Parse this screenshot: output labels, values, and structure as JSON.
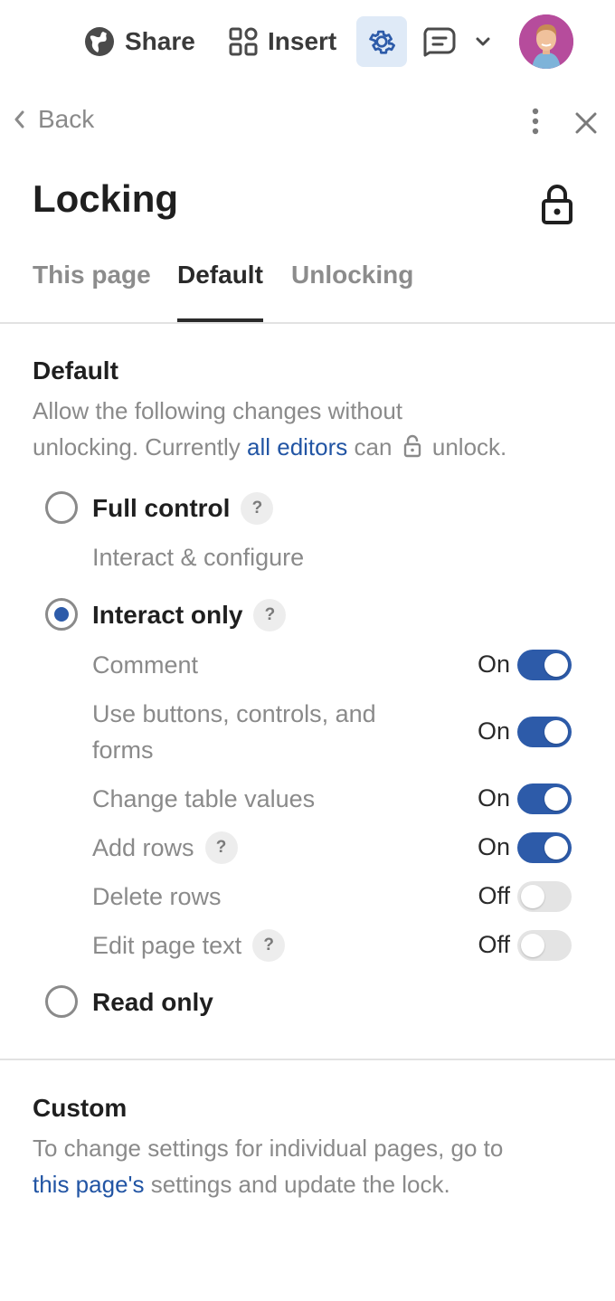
{
  "toolbar": {
    "share_label": "Share",
    "insert_label": "Insert"
  },
  "nav": {
    "back_label": "Back"
  },
  "panel": {
    "title": "Locking",
    "tabs": [
      {
        "label": "This page",
        "active": false
      },
      {
        "label": "Default",
        "active": true
      },
      {
        "label": "Unlocking",
        "active": false
      }
    ]
  },
  "default_section": {
    "title": "Default",
    "desc_line1": "Allow the following changes without",
    "desc_prefix": "unlocking. Currently ",
    "desc_link": "all editors",
    "desc_mid": " can ",
    "desc_suffix": " unlock.",
    "options": [
      {
        "label": "Full control",
        "sub": "Interact & configure",
        "selected": false
      },
      {
        "label": "Interact only",
        "selected": true
      },
      {
        "label": "Read only",
        "selected": false
      }
    ],
    "permissions": [
      {
        "label": "Comment",
        "state": "On"
      },
      {
        "label": "Use buttons, controls, and forms",
        "state": "On"
      },
      {
        "label": "Change table values",
        "state": "On"
      },
      {
        "label": "Add rows",
        "state": "On"
      },
      {
        "label": "Delete rows",
        "state": "Off"
      },
      {
        "label": "Edit page text",
        "state": "Off"
      }
    ],
    "help_glyph": "?"
  },
  "custom_section": {
    "title": "Custom",
    "desc_line1": "To change settings for individual pages, go to",
    "desc_link": "this page's",
    "desc_suffix": " settings and update the lock."
  },
  "colors": {
    "accent": "#2d5ba9",
    "link": "#2255a4",
    "gear_bg": "#dfeaf7"
  },
  "icons": [
    "globe-icon",
    "grid-icon",
    "gear-icon",
    "comment-icon",
    "chevron-down-icon",
    "avatar",
    "chevron-left-icon",
    "more-vertical-icon",
    "close-icon",
    "lock-icon",
    "help-icon"
  ]
}
